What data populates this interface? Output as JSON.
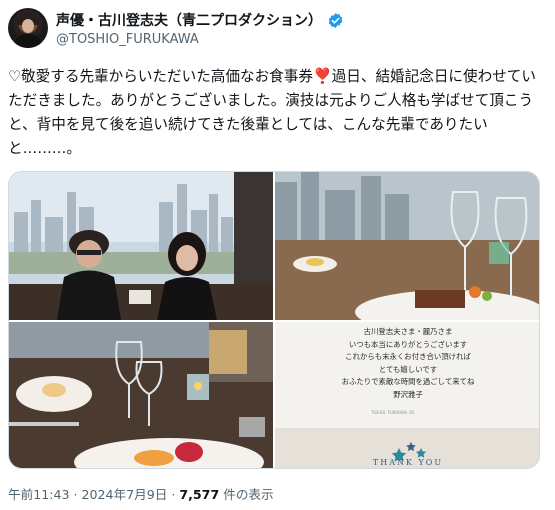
{
  "author": {
    "display_name": "声優・古川登志夫（青二プロダクション）",
    "handle": "@TOSHIO_FURUKAWA",
    "verified_color": "#1d9bf0"
  },
  "tweet": {
    "text_before_heart": "♡敬愛する先輩からいただいた高価なお食事券",
    "heart": "❣️",
    "text_after_heart": "過日、結婚記念日に使わせていただきました。ありがとうございました。演技は元よりご人格も学ばせて頂こうと、背中を見て後を追い続けてきた後輩としては、こんな先輩でありたいと………。"
  },
  "media": {
    "card": {
      "lines": [
        "古川登志夫さま・麗乃さま",
        "いつも本当にありがとうございます",
        "これからも末永くお付き合い頂ければ",
        "とても嬉しいです",
        "おふたりで素敵な時間を過ごして来てね",
        "野沢雅子"
      ],
      "thank_you": "THANK YOU"
    }
  },
  "meta": {
    "time": "午前11:43",
    "sep1": " · ",
    "date": "2024年7月9日",
    "sep2": " · ",
    "views": "7,577",
    "views_suffix": " 件の表示"
  }
}
